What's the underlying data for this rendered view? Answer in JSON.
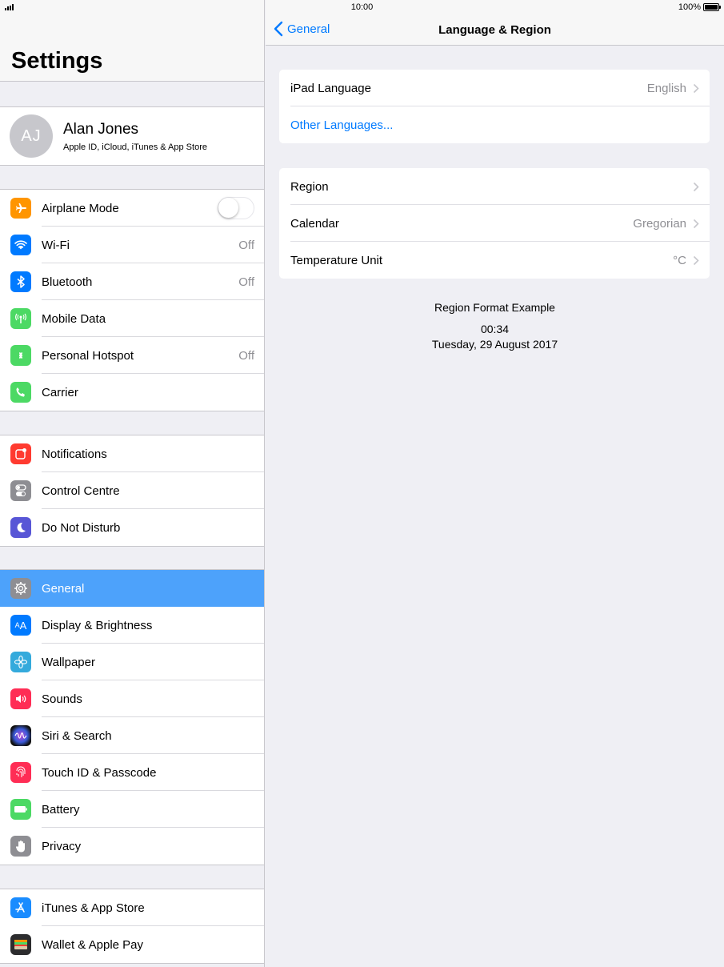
{
  "status": {
    "time": "10:00",
    "battery": "100%",
    "battery_level": 1.0
  },
  "sidebar": {
    "title": "Settings",
    "profile": {
      "initials": "AJ",
      "name": "Alan Jones",
      "subtitle": "Apple ID, iCloud, iTunes & App Store"
    },
    "group1": [
      {
        "label": "Airplane Mode",
        "icon": "airplane-icon",
        "color": "#ff9500",
        "toggle": false
      },
      {
        "label": "Wi-Fi",
        "value": "Off",
        "icon": "wifi-icon",
        "color": "#007aff"
      },
      {
        "label": "Bluetooth",
        "value": "Off",
        "icon": "bluetooth-icon",
        "color": "#007aff"
      },
      {
        "label": "Mobile Data",
        "value": "",
        "icon": "antenna-icon",
        "color": "#4cd964"
      },
      {
        "label": "Personal Hotspot",
        "value": "Off",
        "icon": "hotspot-icon",
        "color": "#4cd964"
      },
      {
        "label": "Carrier",
        "value": "",
        "icon": "phone-icon",
        "color": "#4cd964"
      }
    ],
    "group2": [
      {
        "label": "Notifications",
        "icon": "notifications-icon",
        "color": "#ff3b30"
      },
      {
        "label": "Control Centre",
        "icon": "control-centre-icon",
        "color": "#8e8e93"
      },
      {
        "label": "Do Not Disturb",
        "icon": "moon-icon",
        "color": "#5856d6"
      }
    ],
    "group3": [
      {
        "label": "General",
        "icon": "gear-icon",
        "color": "#8e8e93",
        "selected": true
      },
      {
        "label": "Display & Brightness",
        "icon": "text-size-icon",
        "color": "#007aff"
      },
      {
        "label": "Wallpaper",
        "icon": "flower-icon",
        "color": "#34aadc"
      },
      {
        "label": "Sounds",
        "icon": "speaker-icon",
        "color": "#ff2d55"
      },
      {
        "label": "Siri & Search",
        "icon": "siri-icon",
        "color": "#1c1c3a"
      },
      {
        "label": "Touch ID & Passcode",
        "icon": "fingerprint-icon",
        "color": "#ff2d55"
      },
      {
        "label": "Battery",
        "icon": "battery-icon",
        "color": "#4cd964"
      },
      {
        "label": "Privacy",
        "icon": "hand-icon",
        "color": "#8e8e93"
      }
    ],
    "group4": [
      {
        "label": "iTunes & App Store",
        "icon": "app-store-icon",
        "color": "#1a8cff"
      },
      {
        "label": "Wallet & Apple Pay",
        "icon": "wallet-icon",
        "color": "#2c2c2e"
      }
    ]
  },
  "detail": {
    "back_label": "General",
    "title": "Language & Region",
    "language": {
      "label": "iPad Language",
      "value": "English",
      "other": "Other Languages..."
    },
    "region_rows": [
      {
        "label": "Region",
        "value": ""
      },
      {
        "label": "Calendar",
        "value": "Gregorian"
      },
      {
        "label": "Temperature Unit",
        "value": "°C"
      }
    ],
    "example": {
      "heading": "Region Format Example",
      "time": "00:34",
      "date": "Tuesday, 29 August 2017"
    }
  }
}
